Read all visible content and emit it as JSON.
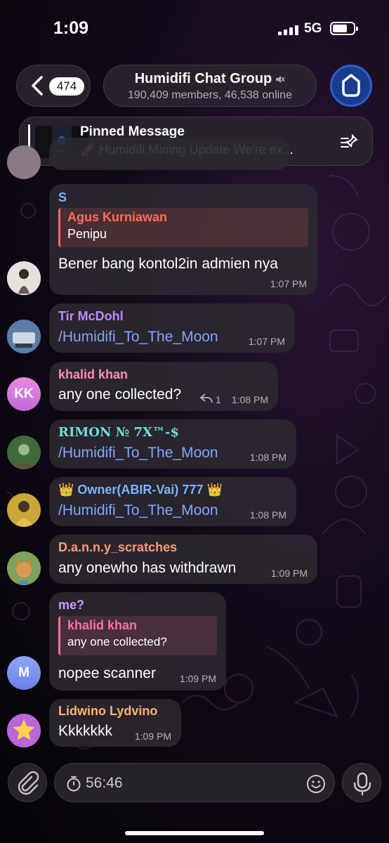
{
  "status": {
    "time": "1:09",
    "network": "5G"
  },
  "header": {
    "back_count": "474",
    "title": "Humidifi Chat Group",
    "subtitle": "190,409 members, 46,538 online"
  },
  "pinned": {
    "label": "Pinned Message",
    "text": "🚀 Humidifi Mining Update We're ex..."
  },
  "messages": [
    {
      "sender": "S",
      "sender_color": "#7ab5ff",
      "reply_name": "Agus Kurniawan",
      "reply_text": "Penipu",
      "reply_color": "#ff6b5b",
      "text": "Bener bang kontol2in admien nya",
      "time": "1:07 PM"
    },
    {
      "sender": "Tir McDohl",
      "sender_color": "#b98cff",
      "text": "/Humidifi_To_The_Moon",
      "time": "1:07 PM"
    },
    {
      "sender": "khalid khan",
      "sender_color": "#ff8db0",
      "text": "any one collected?",
      "reply_count": "1",
      "time": "1:08 PM",
      "avatar_initials": "KK"
    },
    {
      "sender": "RIMON № 7X™-$",
      "sender_color": "#6ee0d8",
      "text": "/Humidifi_To_The_Moon",
      "time": "1:08 PM"
    },
    {
      "sender": "👑 Owner(ABIR-Vai) 777 👑",
      "sender_color": "#7ab5ff",
      "text": "/Humidifi_To_The_Moon",
      "time": "1:08 PM"
    },
    {
      "sender": "D.a.n.n.y_scratches",
      "sender_color": "#ff9b7a",
      "text": "any onewho has withdrawn",
      "time": "1:09 PM"
    },
    {
      "sender": "me?",
      "sender_color": "#c99cff",
      "reply_name": "khalid khan",
      "reply_text": "any one collected?",
      "reply_color": "#ff6fa0",
      "text": "nopee scanner",
      "time": "1:09 PM",
      "avatar_initials": "M"
    },
    {
      "sender": "Lidwino Lydvino",
      "sender_color": "#ffb36b",
      "text": "Kkkkkkk",
      "time": "1:09 PM"
    }
  ],
  "input": {
    "value": "56:46"
  },
  "colors": {
    "link": "#7ea7ff",
    "bubble": "#2c2830",
    "accent": "#2b5fcf"
  }
}
